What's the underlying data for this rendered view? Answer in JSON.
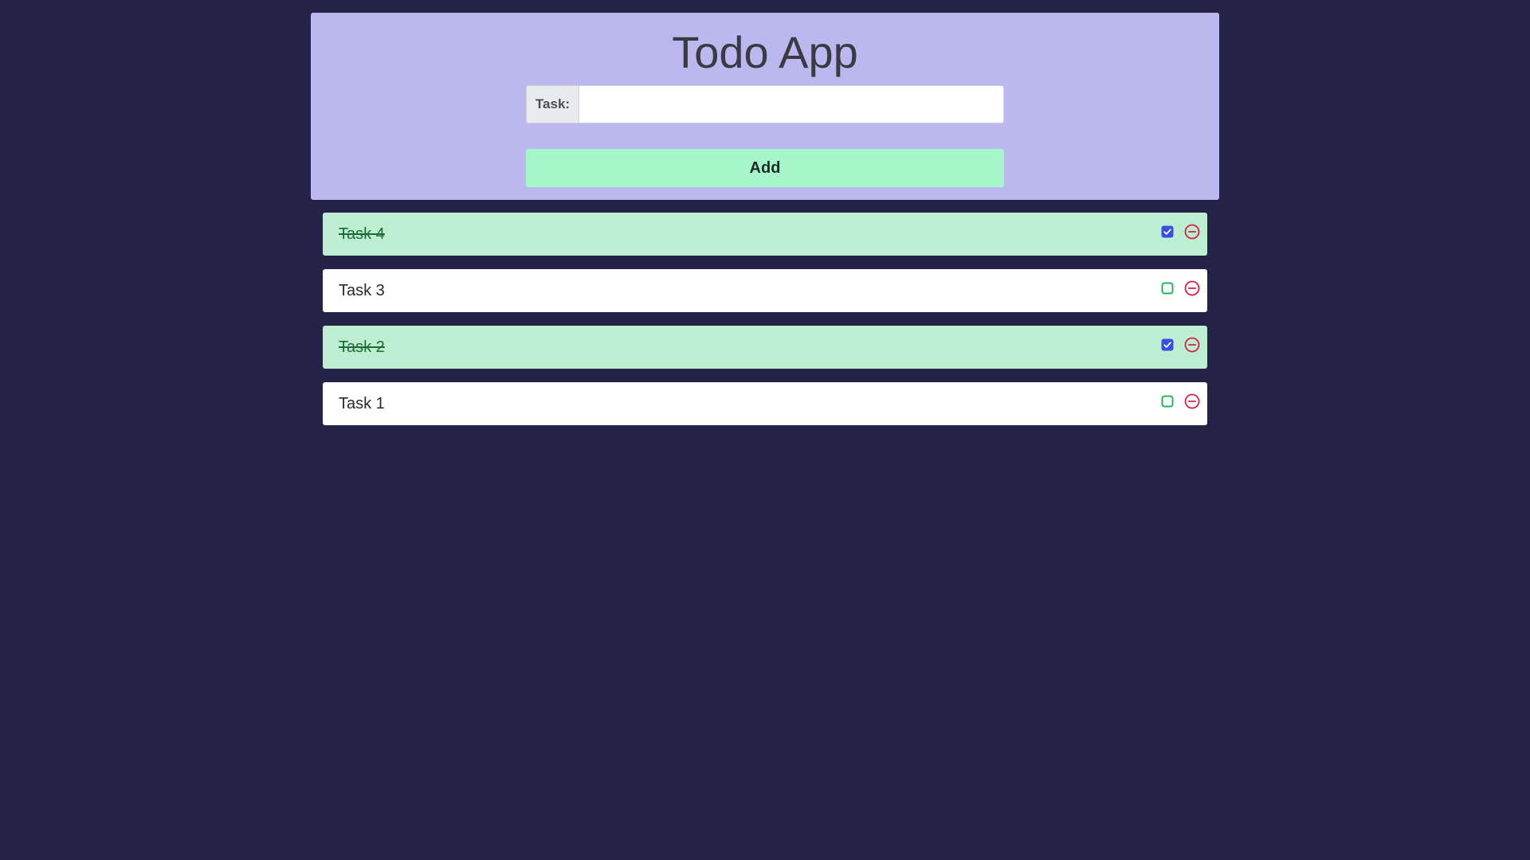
{
  "header": {
    "title": "Todo App"
  },
  "form": {
    "label": "Task:",
    "input_value": "",
    "input_placeholder": "",
    "add_label": "Add"
  },
  "tasks": [
    {
      "text": "Task 4",
      "done": true
    },
    {
      "text": "Task 3",
      "done": false
    },
    {
      "text": "Task 2",
      "done": true
    },
    {
      "text": "Task 1",
      "done": false
    }
  ],
  "colors": {
    "background": "#252248",
    "header_card": "#bab8ee",
    "add_button": "#a7f5cb",
    "done_row": "#bdeed2",
    "checked_box": "#3a4fe0",
    "unchecked_box": "#22b35a",
    "remove_icon": "#d4204c"
  },
  "icons": {
    "checked": "checkbox-checked-icon",
    "unchecked": "checkbox-unchecked-icon",
    "remove": "remove-circle-icon"
  }
}
